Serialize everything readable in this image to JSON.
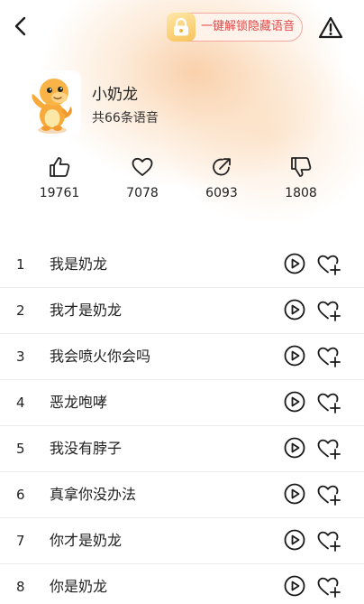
{
  "colors": {
    "accent_red": "#e24a4a",
    "unlock_border": "#f3a9a0",
    "header_glow": "#f6b478",
    "lock_gold": "#f8c35b"
  },
  "header": {
    "back_icon": "chevron-left-icon",
    "unlock_label": "一键解锁隐藏语音",
    "unlock_icon": "lock-icon",
    "report_icon": "warning-triangle-icon"
  },
  "profile": {
    "avatar_icon": "orange-dinosaur-avatar",
    "name": "小奶龙",
    "count_label": "共66条语音"
  },
  "stats": [
    {
      "icon": "thumbs-up-icon",
      "value": "19761"
    },
    {
      "icon": "heart-icon",
      "value": "7078"
    },
    {
      "icon": "share-icon",
      "value": "6093"
    },
    {
      "icon": "thumbs-down-icon",
      "value": "1808"
    }
  ],
  "voices": [
    {
      "index": "1",
      "title": "我是奶龙"
    },
    {
      "index": "2",
      "title": "我才是奶龙"
    },
    {
      "index": "3",
      "title": "我会喷火你会吗"
    },
    {
      "index": "4",
      "title": "恶龙咆哮"
    },
    {
      "index": "5",
      "title": "我没有脖子"
    },
    {
      "index": "6",
      "title": "真拿你没办法"
    },
    {
      "index": "7",
      "title": "你才是奶龙"
    },
    {
      "index": "8",
      "title": "你是奶龙"
    }
  ],
  "row_icons": {
    "play": "play-circle-icon",
    "favorite": "heart-plus-icon"
  }
}
